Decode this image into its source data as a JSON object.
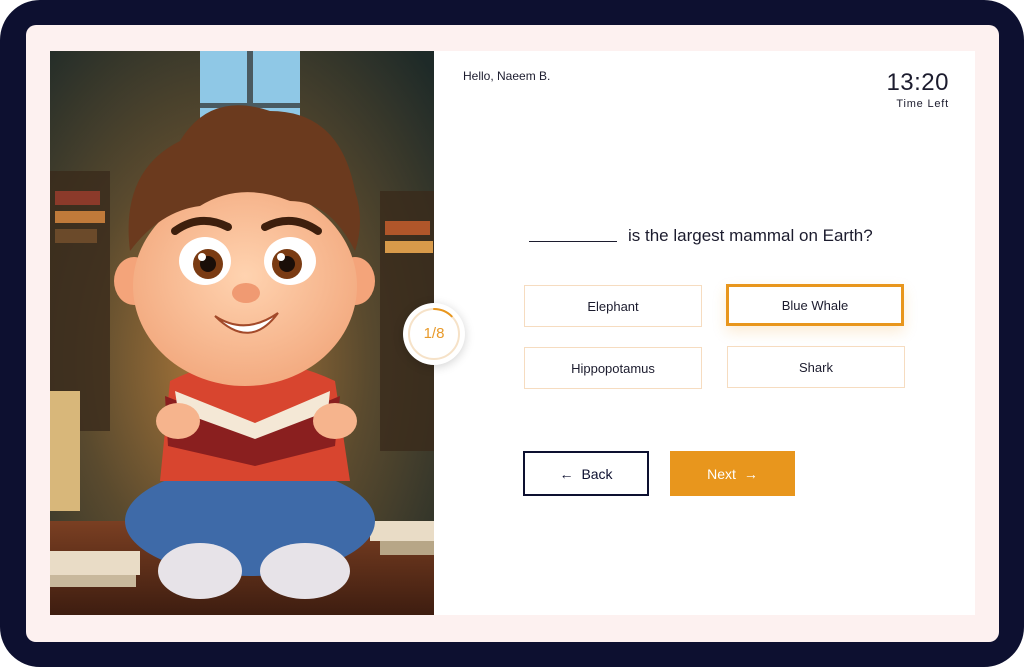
{
  "greeting": "Hello, Naeem B.",
  "timer": {
    "value": "13:20",
    "label": "Time Left"
  },
  "progress": {
    "text": "1/8",
    "current": 1,
    "total": 8
  },
  "question": {
    "text": "is the largest mammal on Earth?"
  },
  "options": [
    {
      "label": "Elephant",
      "selected": false
    },
    {
      "label": "Blue Whale",
      "selected": true
    },
    {
      "label": "Hippopotamus",
      "selected": false
    },
    {
      "label": "Shark",
      "selected": false
    }
  ],
  "buttons": {
    "back": "Back",
    "next": "Next"
  },
  "icons": {
    "back": "arrow-left-icon",
    "next": "arrow-right-icon",
    "illustration": "boy-reading-book"
  },
  "colors": {
    "accent": "#e8961d",
    "frame": "#0d1030",
    "background": "#fdf1f0",
    "option_border": "#f6dcc0"
  }
}
